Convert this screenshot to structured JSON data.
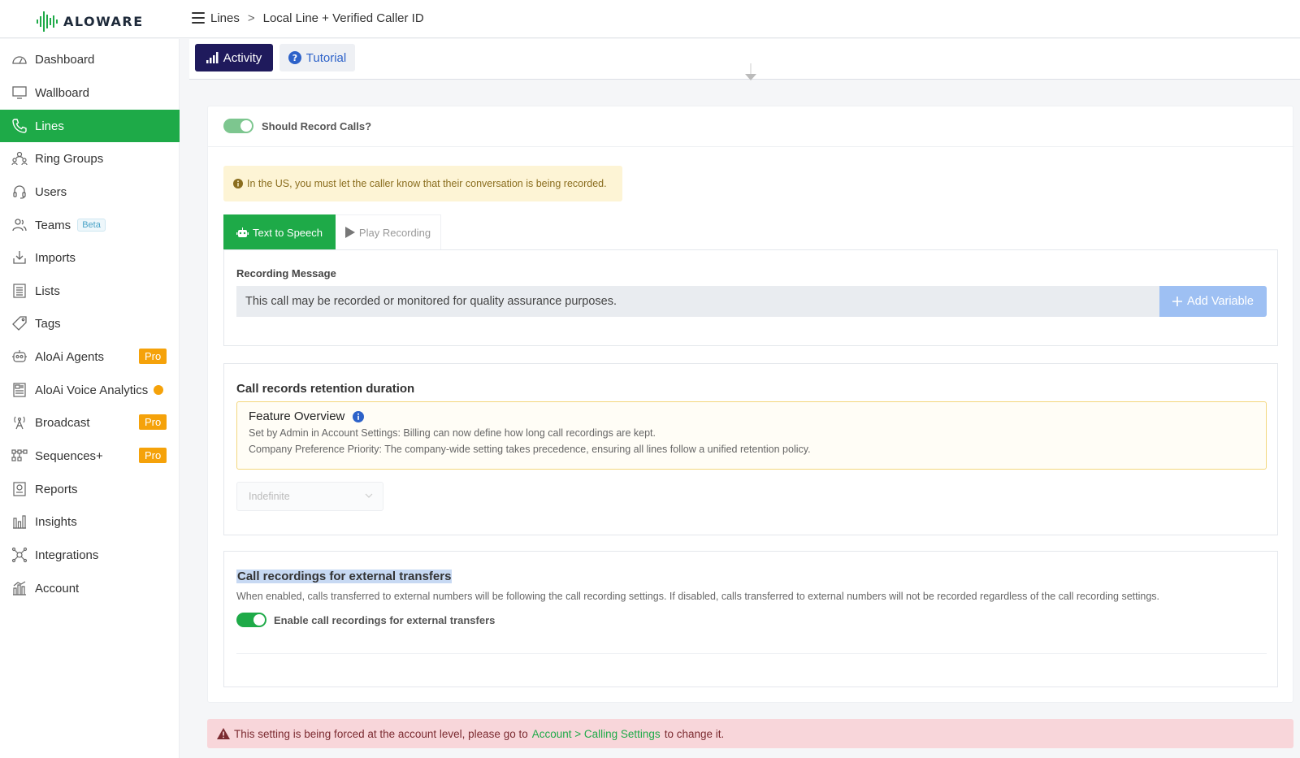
{
  "app": {
    "logo_text": "ALOWARE",
    "brand_color": "#1eaa48"
  },
  "breadcrumb": {
    "items": [
      "Lines",
      "Local Line + Verified Caller ID"
    ],
    "separator": ">"
  },
  "sidebar": {
    "items": [
      {
        "label": "Dashboard",
        "icon": "dashboard-icon"
      },
      {
        "label": "Wallboard",
        "icon": "monitor-icon"
      },
      {
        "label": "Lines",
        "icon": "phone-icon",
        "active": true
      },
      {
        "label": "Ring Groups",
        "icon": "group-icon"
      },
      {
        "label": "Users",
        "icon": "headset-icon"
      },
      {
        "label": "Teams",
        "icon": "teams-icon",
        "badge": "Beta"
      },
      {
        "label": "Imports",
        "icon": "import-icon"
      },
      {
        "label": "Lists",
        "icon": "list-icon"
      },
      {
        "label": "Tags",
        "icon": "tag-icon"
      },
      {
        "label": "AloAi Agents",
        "icon": "robot-icon",
        "badge": "Pro"
      },
      {
        "label": "AloAi Voice Analytics",
        "icon": "analytics-icon",
        "dot": true
      },
      {
        "label": "Broadcast",
        "icon": "broadcast-icon",
        "badge": "Pro"
      },
      {
        "label": "Sequences+",
        "icon": "sequence-icon",
        "badge": "Pro"
      },
      {
        "label": "Reports",
        "icon": "report-icon"
      },
      {
        "label": "Insights",
        "icon": "insights-icon"
      },
      {
        "label": "Integrations",
        "icon": "integrations-icon"
      },
      {
        "label": "Account",
        "icon": "account-icon"
      }
    ]
  },
  "tabs": {
    "activity_label": "Activity",
    "tutorial_label": "Tutorial"
  },
  "recording": {
    "toggle_label": "Should Record Calls?",
    "toggle_on": true,
    "warning": "In the US, you must let the caller know that their conversation is being recorded.",
    "tts_tab": "Text to Speech",
    "play_tab": "Play Recording",
    "message_label": "Recording Message",
    "message_value": "This call may be recorded or monitored for quality assurance purposes.",
    "add_variable": "Add Variable"
  },
  "retention": {
    "title": "Call records retention duration",
    "feature_title": "Feature Overview",
    "feature_line1": "Set by Admin in Account Settings: Billing can now define how long call recordings are kept.",
    "feature_line2": "Company Preference Priority: The company-wide setting takes precedence, ensuring all lines follow a unified retention policy.",
    "selected": "Indefinite"
  },
  "external": {
    "title": "Call recordings for external transfers",
    "description": "When enabled, calls transferred to external numbers will be following the call recording settings. If disabled, calls transferred to external numbers will not be recorded regardless of the call recording settings.",
    "toggle_label": "Enable call recordings for external transfers",
    "toggle_on": true
  },
  "alert": {
    "prefix": "This setting is being forced at the account level, please go to",
    "link": "Account > Calling Settings",
    "suffix": "to change it."
  }
}
